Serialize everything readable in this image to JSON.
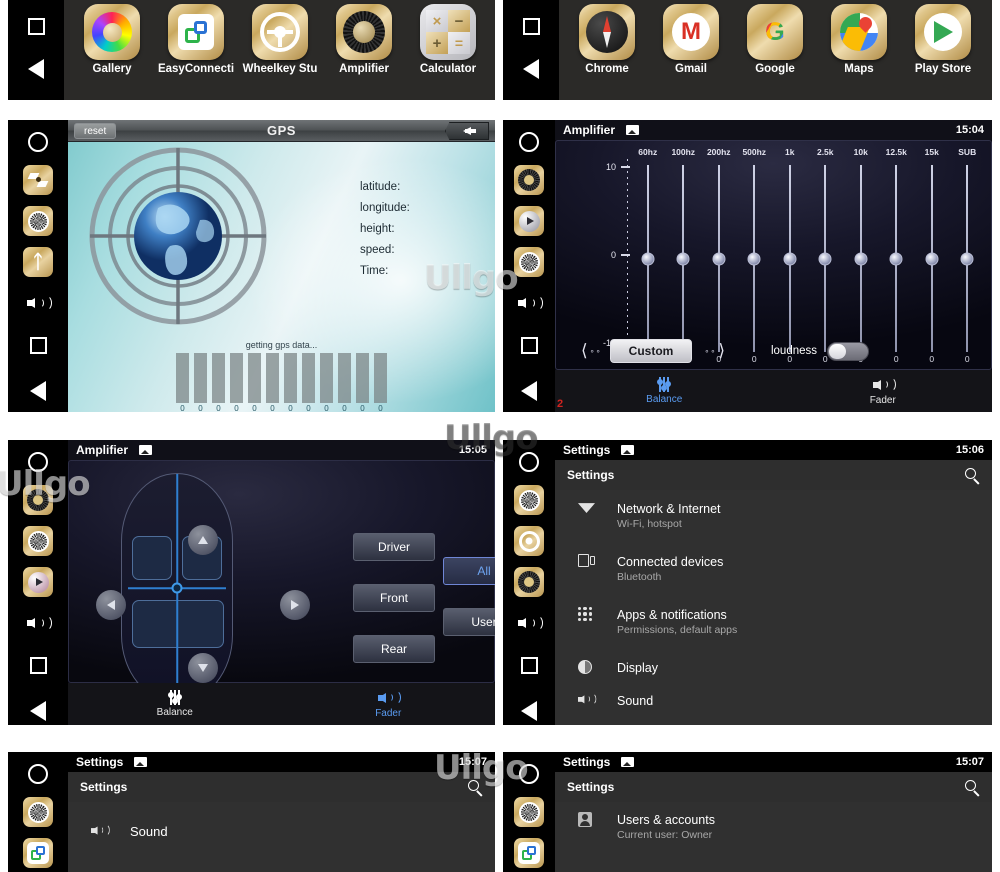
{
  "watermark": {
    "text": "Ullgo"
  },
  "app_drawer_left": {
    "apps": [
      {
        "label": "Gallery",
        "icon": "color-wheel-icon"
      },
      {
        "label": "EasyConnecti",
        "icon": "easyconnect-icon"
      },
      {
        "label": "Wheelkey Stu",
        "icon": "steering-wheel-icon"
      },
      {
        "label": "Amplifier",
        "icon": "amplifier-knob-icon"
      },
      {
        "label": "Calculator",
        "icon": "calculator-icon"
      }
    ]
  },
  "app_drawer_right": {
    "apps": [
      {
        "label": "Chrome",
        "icon": "compass-icon"
      },
      {
        "label": "Gmail",
        "icon": "gmail-icon"
      },
      {
        "label": "Google",
        "icon": "google-g-icon"
      },
      {
        "label": "Maps",
        "icon": "maps-pin-icon"
      },
      {
        "label": "Play Store",
        "icon": "play-store-icon"
      }
    ]
  },
  "gps": {
    "title": "GPS",
    "reset_label": "reset",
    "fields": [
      "latitude:",
      "longitude:",
      "height:",
      "speed:",
      "Time:"
    ],
    "status": "getting gps data...",
    "satellite_values": [
      "0",
      "0",
      "0",
      "0",
      "0",
      "0",
      "0",
      "0",
      "0",
      "0",
      "0",
      "0"
    ]
  },
  "amplifier_eq": {
    "app_title": "Amplifier",
    "clock": "15:04",
    "bands": [
      "60hz",
      "100hz",
      "200hz",
      "500hz",
      "1k",
      "2.5k",
      "10k",
      "12.5k",
      "15k",
      "SUB"
    ],
    "values": [
      "0",
      "0",
      "0",
      "0",
      "0",
      "0",
      "0",
      "0",
      "0",
      "0"
    ],
    "axis": [
      "10",
      "0",
      "-10"
    ],
    "preset": "Custom",
    "prev_dots": "∘∘",
    "next_dots": "∘∘",
    "loudness_label": "loudness",
    "loudness_on": false,
    "tabs": [
      {
        "label": "Balance",
        "active": true,
        "icon": "sliders-icon"
      },
      {
        "label": "Fader",
        "active": false,
        "icon": "speaker-icon"
      }
    ],
    "corner_mark": "2"
  },
  "amplifier_fader": {
    "app_title": "Amplifier",
    "clock": "15:05",
    "seat_presets": [
      "Driver",
      "Front",
      "Rear"
    ],
    "zone_presets": [
      {
        "label": "All",
        "selected": true
      },
      {
        "label": "User",
        "selected": false
      }
    ],
    "tabs": [
      {
        "label": "Balance",
        "active": false,
        "icon": "sliders-icon"
      },
      {
        "label": "Fader",
        "active": true,
        "icon": "speaker-icon"
      }
    ]
  },
  "settings_main": {
    "app_title": "Settings",
    "clock": "15:06",
    "header": "Settings",
    "items": [
      {
        "title": "Network & Internet",
        "subtitle": "Wi-Fi, hotspot",
        "icon": "wifi-icon"
      },
      {
        "title": "Connected devices",
        "subtitle": "Bluetooth",
        "icon": "connected-devices-icon"
      },
      {
        "title": "Apps & notifications",
        "subtitle": "Permissions, default apps",
        "icon": "apps-grid-icon"
      },
      {
        "title": "Display",
        "subtitle": "",
        "icon": "display-brightness-icon"
      },
      {
        "title": "Sound",
        "subtitle": "",
        "icon": "speaker-icon"
      }
    ]
  },
  "settings_sound": {
    "app_title": "Settings",
    "clock": "15:07",
    "header": "Settings",
    "items": [
      {
        "title": "Sound",
        "subtitle": "",
        "icon": "speaker-icon"
      }
    ]
  },
  "settings_users": {
    "app_title": "Settings",
    "clock": "15:07",
    "header": "Settings",
    "items": [
      {
        "title": "Users & accounts",
        "subtitle": "Current user: Owner",
        "icon": "user-icon"
      }
    ]
  }
}
